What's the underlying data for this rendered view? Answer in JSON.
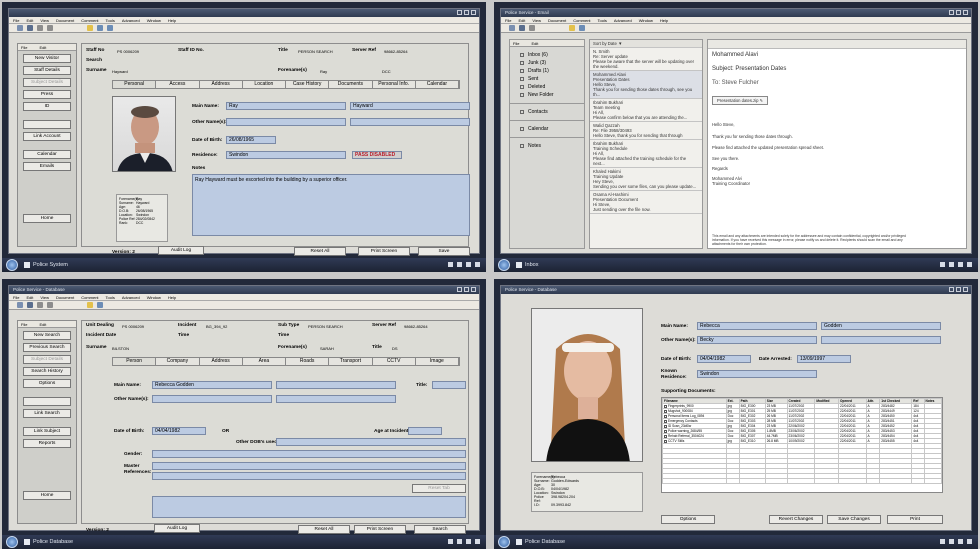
{
  "colors": {
    "field": "#bccbe2",
    "pass_disabled": "#b81d2a",
    "taskbar": "#1c2333"
  },
  "q1": {
    "menus": [
      "File",
      "Edit",
      "View",
      "Document",
      "Comment",
      "Tools",
      "Advanced",
      "Window",
      "Help"
    ],
    "side_hd": [
      "File",
      "Edit"
    ],
    "side_buttons": [
      "New Visitor",
      "Staff Details",
      "Subject Details",
      "Press",
      "ID",
      "",
      "Link Account",
      "Calendar",
      "Emails",
      "",
      "",
      "Home"
    ],
    "staff_no_label": "Staff No",
    "staff_no": "PS 0006209",
    "staff_id_label": "Staff ID No.",
    "title_label": "Title",
    "title_val": "PERSON SEARCH",
    "server_label": "Server Ref",
    "server_val": "98662-85264",
    "search_label": "Search",
    "surname_label": "Surname",
    "surname": "Hayward",
    "forenames_label": "Forename(s)",
    "forenames": "Ray",
    "title2_val": "DCC",
    "tabs": [
      "Personal",
      "Access",
      "Address",
      "Location",
      "Case History",
      "Documents",
      "Personal Info.",
      "Calendar"
    ],
    "main_name_label": "Main Name:",
    "name1": "Ray",
    "name2": "Hayward",
    "other_names_label": "Other Name(s):",
    "dob_label": "Date of Birth:",
    "dob": "26/08/1965",
    "residence_label": "Residence:",
    "residence": "Swindon",
    "pass": "PASS DISABLED",
    "notes_label": "Notes",
    "notes": "Ray Hayward must be escorted into the building by a superior officer.",
    "info": [
      [
        "Forename(s):",
        "Ray"
      ],
      [
        "Surname:",
        "Hayward"
      ],
      [
        "Age:",
        "46"
      ],
      [
        "D.O.B:",
        "26/08/1965"
      ],
      [
        "Location:",
        "Swindon"
      ],
      [
        "Police Ref:",
        "284/02/0842"
      ],
      [
        "Rank:",
        "DCC"
      ]
    ],
    "version": "Version: 2",
    "audit": "Audit Log",
    "reset": "Reset All",
    "print": "Print Screen",
    "save": "Save",
    "task": "Police System"
  },
  "q2": {
    "title": "Police Service - Email",
    "menus": [
      "File",
      "Edit",
      "View",
      "Document",
      "Comment",
      "Tools",
      "Advanced",
      "Window",
      "Help"
    ],
    "side_hd": [
      "File",
      "Edit"
    ],
    "nav": [
      "Inbox (6)",
      "Junk (3)",
      "Drafts (1)",
      "Sent",
      "Deleted",
      "New Folder",
      "Contacts",
      "Calendar",
      "Notes"
    ],
    "sort": "Sort by Date ▼",
    "messages": [
      [
        "N. Smith",
        "Re: Server update",
        "Please be aware that the server will be updating over",
        "the weekend."
      ],
      [
        "Mohammed Alavi",
        "Presentation Dates",
        "Hello Steve,",
        "Thank you for sending those dates through, see you th..."
      ],
      [
        "Ibrahim Bukhari",
        "Team meeting",
        "Hi All,",
        "Please confirm below that you are attending the..."
      ],
      [
        "Walid Qazzah",
        "Re: File 3958/30493",
        "Hello Steve, thank you for sending that through",
        ""
      ],
      [
        "Ibrahim Bukhari",
        "Training Schedule",
        "Hi All,",
        "Please find attached the training schedule for the next..."
      ],
      [
        "Khaled Hakimi",
        "Training Update",
        "Hey Steve,",
        "Sending you over some files, can you please update..."
      ],
      [
        "Osama Al-Hashimi",
        "Presentation Document",
        "Hi Steve,",
        "Just sending over the file now."
      ]
    ],
    "from": "Mohammed Alavi",
    "subject": "Subject: Presentation Dates",
    "to": "To: Steve Fulcher",
    "attachment": "Presentation dates.zip",
    "body": [
      "Hello Steve,",
      "Thank you for sending those dates through.",
      "Please find attached the updated presentation spread sheet.",
      "See you there.",
      "Regards",
      "Mohammed Alvi",
      "Training Coordinator"
    ],
    "disclaimer": [
      "This email and any attachments are intended solely for the addressee and may contain confidential, copyrighted and/or privileged",
      "information.  If you have received this message in error, please notify us and delete it. Recipients should scan the email and any",
      "attachments for their own protection."
    ],
    "task": "Inbox"
  },
  "q3": {
    "title": "Police Service - Database",
    "menus": [
      "File",
      "Edit",
      "View",
      "Document",
      "Comment",
      "Tools",
      "Advanced",
      "Window",
      "Help"
    ],
    "side_hd": [
      "File",
      "Edit"
    ],
    "side_buttons": [
      "New Search",
      "Previous Search",
      "Subject Details",
      "Search History",
      "Options",
      "",
      "",
      "Link Search",
      "",
      "Link Subject",
      "Reports",
      "",
      "Home"
    ],
    "unit_label": "Unit Dealing",
    "unit": "PS 0006209",
    "incident_label": "Incident",
    "incident": "BG_394_92",
    "subtype_label": "Sub Type",
    "subtype": "PERSON SEARCH",
    "server_label": "Server Ref",
    "server": "98662-85264",
    "incdate_label": "Incident Date",
    "time_label": "Time",
    "time2_label": "Time",
    "surname_label": "Surname",
    "surname": "BILSTON",
    "forenames_label": "Forename(s)",
    "forenames": "SARAH",
    "title_label": "Title",
    "title_val": "DS",
    "tabs": [
      "Person",
      "Company",
      "Address",
      "Area",
      "Roads",
      "Transport",
      "CCTV",
      "Image"
    ],
    "main_name_label": "Main Name:",
    "main_name": "Rebecca Godden",
    "title2_label": "Title:",
    "other_names_label": "Other Name(s):",
    "dob_label": "Date of Birth:",
    "dob": "04/04/1982",
    "or": "OR",
    "age_label": "Age at Incident:",
    "other_dob_label": "Other DOB's used:",
    "gender_label": "Gender:",
    "master_label": "Master",
    "references_label": "References:",
    "reset_tab": "Reset Tab",
    "version": "Version: 2",
    "audit": "Audit Log",
    "reset": "Reset All",
    "print": "Print Screen",
    "search": "Search",
    "task": "Police Database"
  },
  "q4": {
    "title": "Police Service - Database",
    "main_name_label": "Main Name:",
    "name1": "Rebecca",
    "name2": "Godden",
    "other_names_label": "Other Name(s):",
    "other_name": "Becky",
    "dob_label": "Date of Birth:",
    "dob": "04/04/1982",
    "arrest_label": "Date Arrested:",
    "arrest": "13/09/1997",
    "known_label": "Known",
    "residence_label": "Residence:",
    "residence": "Swindon",
    "supporting": "Supporting Documents:",
    "info": [
      [
        "Forename(s):",
        "Rebecca"
      ],
      [
        "Surname:",
        "Godden-Edwards"
      ],
      [
        "Age:",
        "30"
      ],
      [
        "D.O.B:",
        "04/04/1982"
      ],
      [
        "Location:",
        "Swindon"
      ],
      [
        "Police Ref:",
        "398.98204.204"
      ],
      [
        "I.D:",
        "09.3993.842"
      ]
    ],
    "columns": [
      "Filename",
      "Ext.",
      "Path",
      "Size",
      "Created",
      "Modified",
      "Opened",
      "Attr.",
      "1st Checked",
      "Ref",
      "Notes"
    ],
    "rows": [
      [
        "Fingerprints_9900",
        "jpg",
        "BIG_E300",
        "23 MB",
        "11/07/2002",
        "",
        "22/04/2011",
        "A",
        "283/4482",
        "184",
        ""
      ],
      [
        "Mugshot_900084",
        "jpg",
        "BIG_E301",
        "25 MB",
        "11/07/2002",
        "",
        "22/04/2011",
        "A",
        "283/4449",
        "124",
        ""
      ],
      [
        "Personal Items Log_0894",
        "Doc",
        "BIG_E302",
        "26 MB",
        "11/07/2002",
        "",
        "22/04/2011",
        "A",
        "283/4450",
        "4x4",
        ""
      ],
      [
        "Emergency Contacts",
        "Doc",
        "BIG_E303",
        "28 MB",
        "11/07/2002",
        "",
        "22/04/2011",
        "A",
        "283/4451",
        "4x4",
        ""
      ],
      [
        "ID Scan_23d0lw",
        "jpg",
        "BIG_E304",
        "23 MB",
        "22/06/2002",
        "",
        "22/04/2011",
        "A",
        "283/4452",
        "4x4",
        ""
      ],
      [
        "Police warning_2684/55",
        "Doc",
        "BIG_E305",
        "1.8MB",
        "23/06/2002",
        "",
        "22/04/2011",
        "A",
        "283/4453",
        "4x4",
        ""
      ],
      [
        "Rehab Referral_3504024",
        "Doc",
        "BIG_E307",
        "44.7MB",
        "23/06/2002",
        "",
        "22/04/2011",
        "A",
        "283/4454",
        "4x4",
        ""
      ],
      [
        "CCTV Stills",
        "jpg",
        "BIG_E310",
        "26.8 MB",
        "10/09/2002",
        "",
        "22/04/2011",
        "A",
        "283/4455",
        "4x4",
        ""
      ]
    ],
    "options": "Options",
    "revert": "Revert Changes",
    "save": "Save Changes",
    "print": "Print",
    "task": "Police Database"
  }
}
